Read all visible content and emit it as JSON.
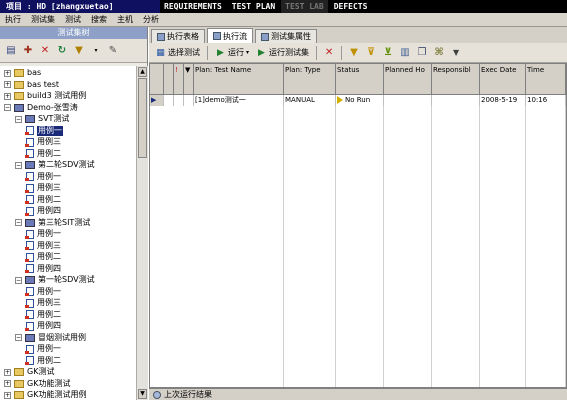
{
  "topbar": {
    "project": "项目 : HD [zhangxuetao]",
    "tabs": [
      {
        "label": "REQUIREMENTS",
        "active": false
      },
      {
        "label": "TEST PLAN",
        "active": false
      },
      {
        "label": "TEST LAB",
        "active": true
      },
      {
        "label": "DEFECTS",
        "active": false
      }
    ]
  },
  "menu": [
    "执行",
    "测试集",
    "测试",
    "搜索",
    "主机",
    "分析"
  ],
  "left_panel": {
    "header": "测试集树",
    "tree": [
      {
        "label": "bas",
        "type": "folder",
        "depth": 0,
        "expander": "+"
      },
      {
        "label": "bas test",
        "type": "folder",
        "depth": 0,
        "expander": "+"
      },
      {
        "label": "build3 测试用例",
        "type": "folder",
        "depth": 0,
        "expander": "+"
      },
      {
        "label": "Demo-张雪涛",
        "type": "folder-open",
        "depth": 0,
        "expander": "−"
      },
      {
        "label": "SVT测试",
        "type": "folder-open",
        "depth": 1,
        "expander": "−"
      },
      {
        "label": "用例一",
        "type": "test",
        "depth": 2,
        "selected": true
      },
      {
        "label": "用例三",
        "type": "test",
        "depth": 2
      },
      {
        "label": "用例二",
        "type": "test",
        "depth": 2
      },
      {
        "label": "第二轮SDV测试",
        "type": "folder-open",
        "depth": 1,
        "expander": "−"
      },
      {
        "label": "用例一",
        "type": "test",
        "depth": 2
      },
      {
        "label": "用例三",
        "type": "test",
        "depth": 2
      },
      {
        "label": "用例二",
        "type": "test",
        "depth": 2
      },
      {
        "label": "用例四",
        "type": "test",
        "depth": 2
      },
      {
        "label": "第三轮SIT测试",
        "type": "folder-open",
        "depth": 1,
        "expander": "−"
      },
      {
        "label": "用例一",
        "type": "test",
        "depth": 2
      },
      {
        "label": "用例三",
        "type": "test",
        "depth": 2
      },
      {
        "label": "用例二",
        "type": "test",
        "depth": 2
      },
      {
        "label": "用例四",
        "type": "test",
        "depth": 2
      },
      {
        "label": "第一轮SDV测试",
        "type": "folder-open",
        "depth": 1,
        "expander": "−"
      },
      {
        "label": "用例一",
        "type": "test",
        "depth": 2
      },
      {
        "label": "用例三",
        "type": "test",
        "depth": 2
      },
      {
        "label": "用例二",
        "type": "test",
        "depth": 2
      },
      {
        "label": "用例四",
        "type": "test",
        "depth": 2
      },
      {
        "label": "冒烟测试用例",
        "type": "folder-open",
        "depth": 1,
        "expander": "−"
      },
      {
        "label": "用例一",
        "type": "test",
        "depth": 2
      },
      {
        "label": "用例二",
        "type": "test",
        "depth": 2
      },
      {
        "label": "GK测试",
        "type": "folder",
        "depth": 0,
        "expander": "+"
      },
      {
        "label": "GK功能测试",
        "type": "folder",
        "depth": 0,
        "expander": "+"
      },
      {
        "label": "GK功能测试用例",
        "type": "folder",
        "depth": 0,
        "expander": "+"
      }
    ]
  },
  "right_panel": {
    "tabs": [
      {
        "label": "执行表格",
        "active": false
      },
      {
        "label": "执行流",
        "active": true
      },
      {
        "label": "测试集属性",
        "active": false
      }
    ],
    "toolbar": {
      "select_tests": "选择测试",
      "run": "运行",
      "run_set": "运行测试集"
    },
    "columns": [
      "",
      "",
      "!",
      "",
      "Plan: Test Name",
      "Plan: Type",
      "Status",
      "Planned Ho",
      "Responsibl",
      "Exec Date",
      "Time"
    ],
    "rows": [
      {
        "test_name": "[1]demo测试一",
        "type": "MANUAL",
        "status": "No Run",
        "planned_host": "",
        "responsible": "",
        "exec_date": "2008-5-19",
        "time": "10:16"
      }
    ],
    "status_bar": "上次运行结果"
  }
}
